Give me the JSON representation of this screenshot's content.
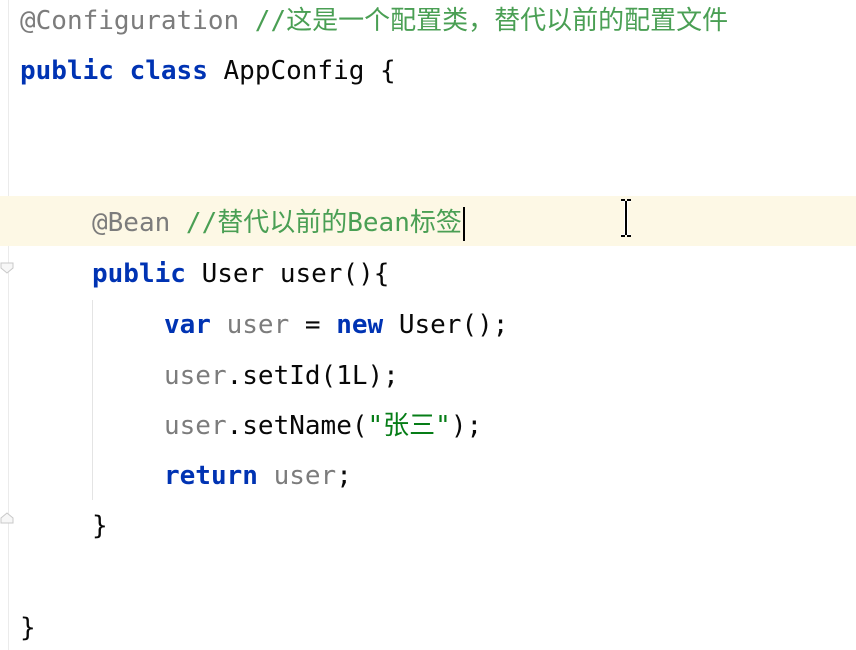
{
  "editor": {
    "lines": {
      "l1": {
        "annotation": "@Configuration",
        "comment": " //这是一个配置类，替代以前的配置文件"
      },
      "l2": {
        "kw_public": "public",
        "kw_class": "class",
        "class_name": "AppConfig {"
      },
      "l3": {
        "annotation": "@Bean",
        "comment": " //替代以前的Bean标签"
      },
      "l4": {
        "kw_public": "public",
        "signature": "User user(){"
      },
      "l5": {
        "kw_var": "var",
        "var_name": "user",
        "assign": " = ",
        "kw_new": "new",
        "ctor": " User();"
      },
      "l6": {
        "var_name": "user",
        "call": ".setId(1L);"
      },
      "l7": {
        "var_name": "user",
        "call_open": ".setName(",
        "string": "\"张三\"",
        "call_close": ");"
      },
      "l8": {
        "kw_return": "return",
        "var_name": "user",
        "end": ";"
      },
      "l9": {
        "brace": "}"
      },
      "l10": {
        "brace": "}"
      }
    },
    "colors": {
      "background": "#ffffff",
      "current_line": "#fdf8e5",
      "keyword": "#0033b3",
      "annotation": "#7c7c7c",
      "comment": "#4a9f54",
      "string": "#067d17",
      "local_variable": "#7c7c7c",
      "text": "#080808"
    },
    "icons": {
      "fold_open": "fold-arrow-down-icon",
      "fold_close": "fold-arrow-up-icon",
      "mouse_cursor": "text-ibeam-cursor-icon"
    }
  }
}
